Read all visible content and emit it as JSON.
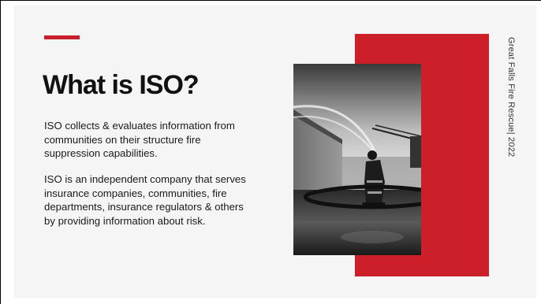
{
  "slide": {
    "title": "What is ISO?",
    "paragraph1": "ISO collects & evaluates information from communities on their structure fire suppression capabilities.",
    "paragraph2": "ISO is an independent company that serves insurance companies, communities, fire departments, insurance regulators & others by providing information about risk.",
    "side_text": "Great Falls Fire Rescue| 2022"
  },
  "colors": {
    "accent": "#cc1f2a",
    "background": "#f5f5f5",
    "text": "#111111"
  }
}
